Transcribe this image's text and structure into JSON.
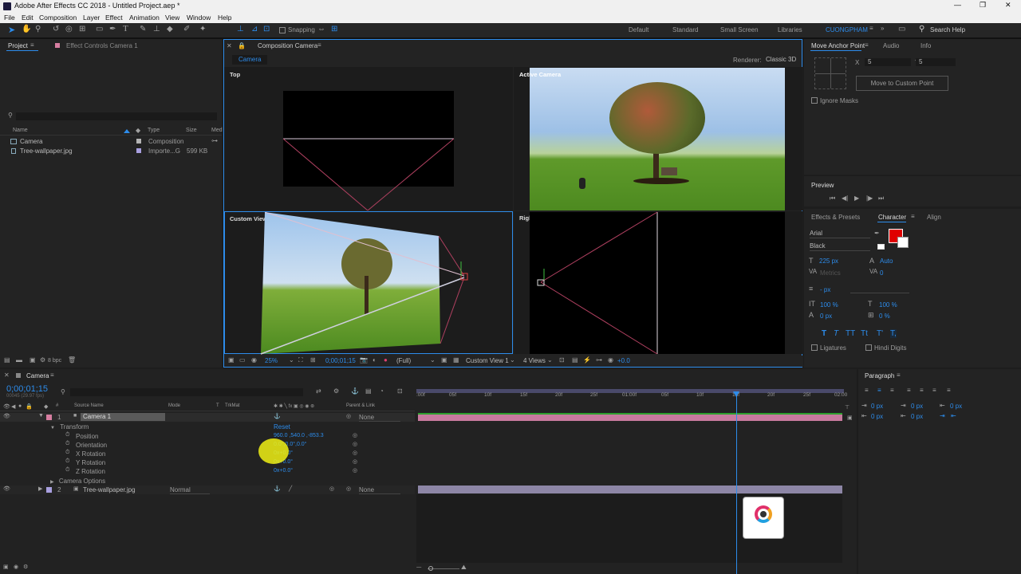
{
  "titlebar": {
    "title": "Adobe After Effects CC 2018 - Untitled Project.aep *",
    "min": "—",
    "max": "❐",
    "close": "✕"
  },
  "menu": [
    "File",
    "Edit",
    "Composition",
    "Layer",
    "Effect",
    "Animation",
    "View",
    "Window",
    "Help"
  ],
  "toolbar": {
    "snapping": "Snapping",
    "workspaces": [
      "Default",
      "Standard",
      "Small Screen",
      "Libraries"
    ],
    "user": "CUONGPHAM",
    "search_placeholder": "Search Help"
  },
  "project": {
    "tab": "Project",
    "effect_controls": "Effect Controls Camera 1",
    "columns": {
      "name": "Name",
      "type": "Type",
      "size": "Size",
      "media": "Med"
    },
    "items": [
      {
        "name": "Camera",
        "type": "Composition",
        "size": "",
        "color": "#b4b4b4"
      },
      {
        "name": "Tree-wallpaper.jpg",
        "type": "Importe...G",
        "size": "599 KB",
        "color": "#a9a0e0"
      }
    ],
    "bpc": "8 bpc"
  },
  "comp": {
    "tab": "Composition Camera",
    "subtab": "Camera",
    "renderer_label": "Renderer:",
    "renderer": "Classic 3D",
    "views": {
      "top": "Top",
      "active": "Active Camera",
      "custom": "Custom View 1",
      "right": "Right"
    },
    "footer": {
      "zoom": "25%",
      "timecode": "0;00;01;15",
      "quality": "(Full)",
      "view": "Custom View 1",
      "layout": "4 Views",
      "exposure": "+0.0"
    }
  },
  "anchor": {
    "tab": "Move Anchor Point",
    "audio": "Audio",
    "info": "Info",
    "x_label": "X",
    "x": "5",
    "y_label": "Y",
    "y": "5",
    "button": "Move to Custom Point",
    "ignore_masks": "Ignore Masks"
  },
  "preview": {
    "title": "Preview",
    "controls": [
      "⏮",
      "◀|",
      "▶",
      "|▶",
      "⏭"
    ]
  },
  "character": {
    "tabs": [
      "Effects & Presets",
      "Character",
      "Align"
    ],
    "font": "Arial",
    "style": "Black",
    "size": "225 px",
    "leading": "Auto",
    "kerning": "Metrics",
    "tracking": "0",
    "stroke": "- px",
    "vscale": "100 %",
    "hscale": "100 %",
    "baseline": "0 px",
    "tsume": "0 %",
    "styles": [
      "T",
      "T",
      "TT",
      "Tt",
      "T'",
      "T,"
    ],
    "ligatures": "Ligatures",
    "hindi": "Hindi Digits",
    "fill_color": "#e00000"
  },
  "timeline": {
    "tab": "Camera",
    "timecode": "0;00;01;15",
    "sub": "00045 (29.97 fps)",
    "cols": {
      "source": "Source Name",
      "mode": "Mode",
      "t": "T",
      "trkmat": "TrkMat",
      "parent": "Parent & Link"
    },
    "ruler": [
      ":00f",
      "05f",
      "10f",
      "15f",
      "20f",
      "25f",
      "01:00f",
      "05f",
      "10f",
      "15f",
      "20f",
      "25f",
      "02:00"
    ],
    "layers": [
      {
        "num": "1",
        "name": "Camera 1",
        "parent": "None",
        "color": "#d77ea1"
      },
      {
        "num": "2",
        "name": "Tree-wallpaper.jpg",
        "mode": "Normal",
        "parent": "None",
        "color": "#a9a0e0"
      }
    ],
    "transform": {
      "label": "Transform",
      "reset": "Reset",
      "props": [
        {
          "name": "Position",
          "value": "960.0 ,540.0 ,-853.3"
        },
        {
          "name": "Orientation",
          "value": "0.0°,0.0°,0.0°"
        },
        {
          "name": "X Rotation",
          "value": "0x+0.0°"
        },
        {
          "name": "Y Rotation",
          "value": "0x+0.0°"
        },
        {
          "name": "Z Rotation",
          "value": "0x+0.0°"
        }
      ]
    },
    "camera_options": "Camera Options"
  },
  "paragraph": {
    "title": "Paragraph",
    "v1": "0 px",
    "v2": "0 px",
    "v3": "0 px",
    "v4": "0 px",
    "v5": "0 px"
  }
}
